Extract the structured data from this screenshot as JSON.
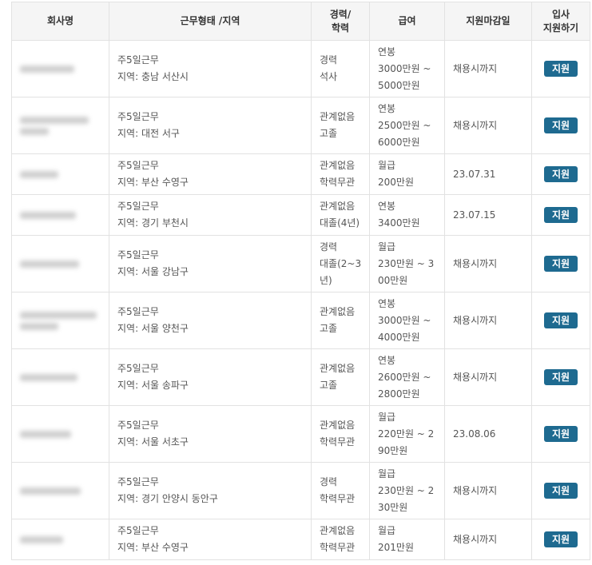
{
  "colors": {
    "header_bg": "#f5f5f5",
    "border": "#e2e2e2",
    "apply_button": "#1e6a90"
  },
  "headers": {
    "company": "회사명",
    "work": "근무형태 /지역",
    "career": [
      "경력/",
      "학력"
    ],
    "salary": "급여",
    "deadline": "지원마감일",
    "apply": [
      "입사",
      "지원하기"
    ]
  },
  "rows": [
    {
      "work": [
        "주5일근무",
        "지역: 충남 서산시"
      ],
      "career": [
        "경력",
        "석사"
      ],
      "salary": [
        "연봉",
        "3000만원 ~",
        "5000만원"
      ],
      "deadline": "채용시까지",
      "apply": "지원"
    },
    {
      "work": [
        "주5일근무",
        "지역: 대전 서구"
      ],
      "career": [
        "관계없음",
        "고졸"
      ],
      "salary": [
        "연봉",
        "2500만원 ~",
        "6000만원"
      ],
      "deadline": "채용시까지",
      "apply": "지원"
    },
    {
      "work": [
        "주5일근무",
        "지역: 부산 수영구"
      ],
      "career": [
        "관계없음",
        "학력무관"
      ],
      "salary": [
        "월급",
        "200만원"
      ],
      "deadline": "23.07.31",
      "apply": "지원"
    },
    {
      "work": [
        "주5일근무",
        "지역: 경기 부천시"
      ],
      "career": [
        "관계없음",
        "대졸(4년)"
      ],
      "salary": [
        "연봉",
        "3400만원"
      ],
      "deadline": "23.07.15",
      "apply": "지원"
    },
    {
      "work": [
        "주5일근무",
        "지역: 서울 강남구"
      ],
      "career": [
        "경력",
        "대졸(2~3",
        "년)"
      ],
      "salary": [
        "월급",
        "230만원 ~ 3",
        "00만원"
      ],
      "deadline": "채용시까지",
      "apply": "지원"
    },
    {
      "work": [
        "주5일근무",
        "지역: 서울 양천구"
      ],
      "career": [
        "관계없음",
        "고졸"
      ],
      "salary": [
        "연봉",
        "3000만원 ~",
        "4000만원"
      ],
      "deadline": "채용시까지",
      "apply": "지원"
    },
    {
      "work": [
        "주5일근무",
        "지역: 서울 송파구"
      ],
      "career": [
        "관계없음",
        "고졸"
      ],
      "salary": [
        "연봉",
        "2600만원 ~",
        "2800만원"
      ],
      "deadline": "채용시까지",
      "apply": "지원"
    },
    {
      "work": [
        "주5일근무",
        "지역: 서울 서초구"
      ],
      "career": [
        "관계없음",
        "학력무관"
      ],
      "salary": [
        "월급",
        "220만원 ~ 2",
        "90만원"
      ],
      "deadline": "23.08.06",
      "apply": "지원"
    },
    {
      "work": [
        "주5일근무",
        "지역: 경기 안양시 동안구"
      ],
      "career": [
        "경력",
        "학력무관"
      ],
      "salary": [
        "월급",
        "230만원 ~ 2",
        "30만원"
      ],
      "deadline": "채용시까지",
      "apply": "지원"
    },
    {
      "work": [
        "주5일근무",
        "지역: 부산 수영구"
      ],
      "career": [
        "관계없음",
        "학력무관"
      ],
      "salary": [
        "월급",
        "201만원"
      ],
      "deadline": "채용시까지",
      "apply": "지원"
    }
  ]
}
